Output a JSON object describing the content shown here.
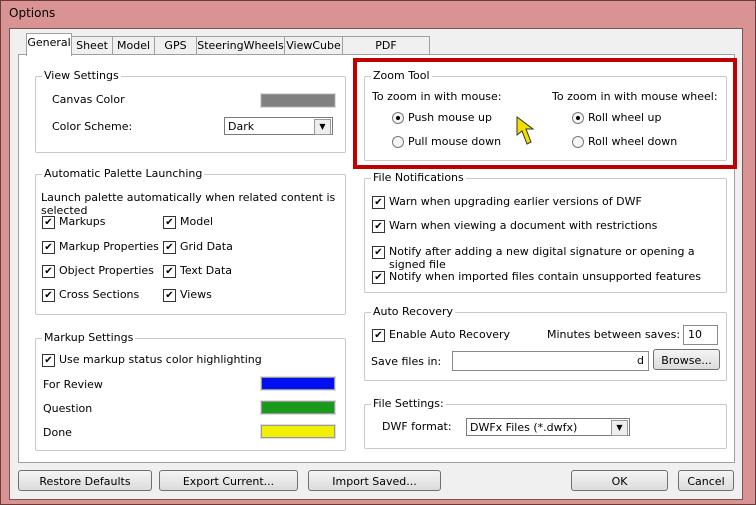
{
  "window": {
    "title": "Options"
  },
  "tabs": [
    "General",
    "Sheet",
    "Model",
    "GPS",
    "SteeringWheels",
    "ViewCube",
    "PDF Conversion"
  ],
  "view_settings": {
    "title": "View Settings",
    "canvas_color_label": "Canvas Color",
    "canvas_color": "#808080",
    "color_scheme_label": "Color Scheme:",
    "color_scheme_value": "Dark"
  },
  "palette": {
    "title": "Automatic Palette Launching",
    "description": "Launch palette automatically when related content is selected",
    "items": [
      {
        "label": "Markups",
        "checked": true
      },
      {
        "label": "Model",
        "checked": true
      },
      {
        "label": "Markup Properties",
        "checked": true
      },
      {
        "label": "Grid Data",
        "checked": true
      },
      {
        "label": "Object Properties",
        "checked": true
      },
      {
        "label": "Text Data",
        "checked": true
      },
      {
        "label": "Cross Sections",
        "checked": true
      },
      {
        "label": "Views",
        "checked": true
      }
    ]
  },
  "markup_settings": {
    "title": "Markup Settings",
    "status_color_label": "Use markup status color highlighting",
    "status_color_checked": true,
    "statuses": [
      {
        "label": "For Review",
        "color": "#0010f0"
      },
      {
        "label": "Question",
        "color": "#1a9a1a"
      },
      {
        "label": "Done",
        "color": "#f0f000"
      }
    ]
  },
  "zoom_tool": {
    "title": "Zoom Tool",
    "highlight_color": "#c00000",
    "mouse_label": "To zoom in with mouse:",
    "mouse_options": [
      "Push mouse up",
      "Pull mouse down"
    ],
    "mouse_selected": 0,
    "wheel_label": "To zoom in with mouse wheel:",
    "wheel_options": [
      "Roll wheel up",
      "Roll wheel down"
    ],
    "wheel_selected": 0
  },
  "file_notifications": {
    "title": "File Notifications",
    "items": [
      "Warn when upgrading earlier versions of DWF",
      "Warn when viewing a document with restrictions",
      "Notify after adding a new digital signature or opening a signed file",
      "Notify when imported files contain unsupported features"
    ]
  },
  "auto_recovery": {
    "title": "Auto Recovery",
    "enable_label": "Enable Auto Recovery",
    "enabled": true,
    "minutes_label": "Minutes between saves:",
    "minutes_value": "10",
    "save_label": "Save files in:",
    "save_path": "d",
    "browse_label": "Browse..."
  },
  "file_settings": {
    "title": "File Settings:",
    "dwf_label": "DWF format:",
    "dwf_value": "DWFx Files (*.dwfx)"
  },
  "buttons": {
    "restore": "Restore Defaults",
    "export": "Export Current...",
    "import": "Import Saved...",
    "ok": "OK",
    "cancel": "Cancel"
  }
}
